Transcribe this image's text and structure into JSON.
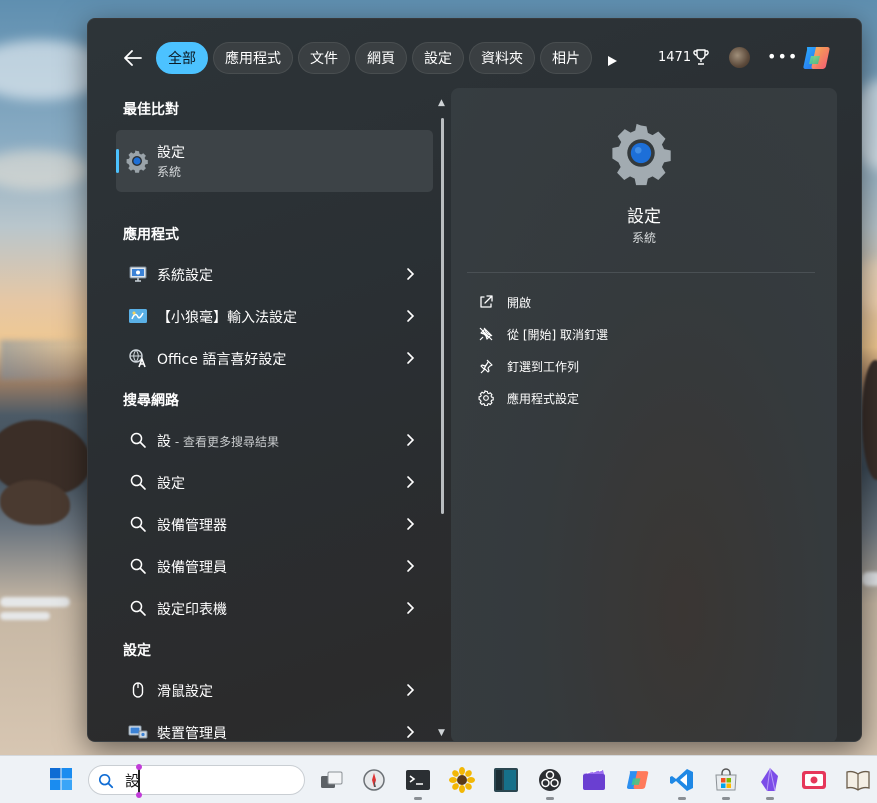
{
  "search_panel": {
    "tabs": [
      {
        "label": "全部",
        "active": true
      },
      {
        "label": "應用程式"
      },
      {
        "label": "文件"
      },
      {
        "label": "網頁"
      },
      {
        "label": "設定"
      },
      {
        "label": "資料夾"
      },
      {
        "label": "相片"
      }
    ],
    "points": "1471",
    "more_label": "•••"
  },
  "results": {
    "best_match_header": "最佳比對",
    "best_match": {
      "title": "設定",
      "subtitle": "系統"
    },
    "apps_header": "應用程式",
    "apps": [
      {
        "label": "系統設定",
        "icon": "monitor-settings-icon"
      },
      {
        "label": "【小狼毫】輸入法設定",
        "icon": "keyboard-ime-icon"
      },
      {
        "label": "Office 語言喜好設定",
        "icon": "office-language-icon"
      }
    ],
    "web_header": "搜尋網路",
    "web": [
      {
        "label": "設",
        "suffix": " - 查看更多搜尋結果"
      },
      {
        "label": "設定",
        "suffix": ""
      },
      {
        "label": "設備管理器",
        "suffix": ""
      },
      {
        "label": "設備管理員",
        "suffix": ""
      },
      {
        "label": "設定印表機",
        "suffix": ""
      }
    ],
    "settings_header": "設定",
    "settings": [
      {
        "label": "滑鼠設定",
        "icon": "mouse-icon"
      },
      {
        "label": "裝置管理員",
        "icon": "device-manager-icon"
      }
    ]
  },
  "preview": {
    "title": "設定",
    "subtitle": "系統",
    "actions": [
      {
        "label": "開啟",
        "icon": "open-icon"
      },
      {
        "label": "從 [開始] 取消釘選",
        "icon": "unpin-icon"
      },
      {
        "label": "釘選到工作列",
        "icon": "pin-icon"
      },
      {
        "label": "應用程式設定",
        "icon": "gear-icon"
      }
    ]
  },
  "taskbar": {
    "search_value": "設",
    "apps": [
      {
        "name": "task-view"
      },
      {
        "name": "compass"
      },
      {
        "name": "terminal"
      },
      {
        "name": "sunflower"
      },
      {
        "name": "sidebar-app"
      },
      {
        "name": "obs-studio"
      },
      {
        "name": "clipchamp"
      },
      {
        "name": "copilot"
      },
      {
        "name": "vscode"
      },
      {
        "name": "microsoft-store"
      },
      {
        "name": "obsidian"
      },
      {
        "name": "screen-recorder"
      },
      {
        "name": "book-reader"
      }
    ]
  },
  "colors": {
    "accent": "#4cc2ff",
    "panel_bg": "#2b2f32",
    "taskbar_bg": "#eef2f6"
  }
}
